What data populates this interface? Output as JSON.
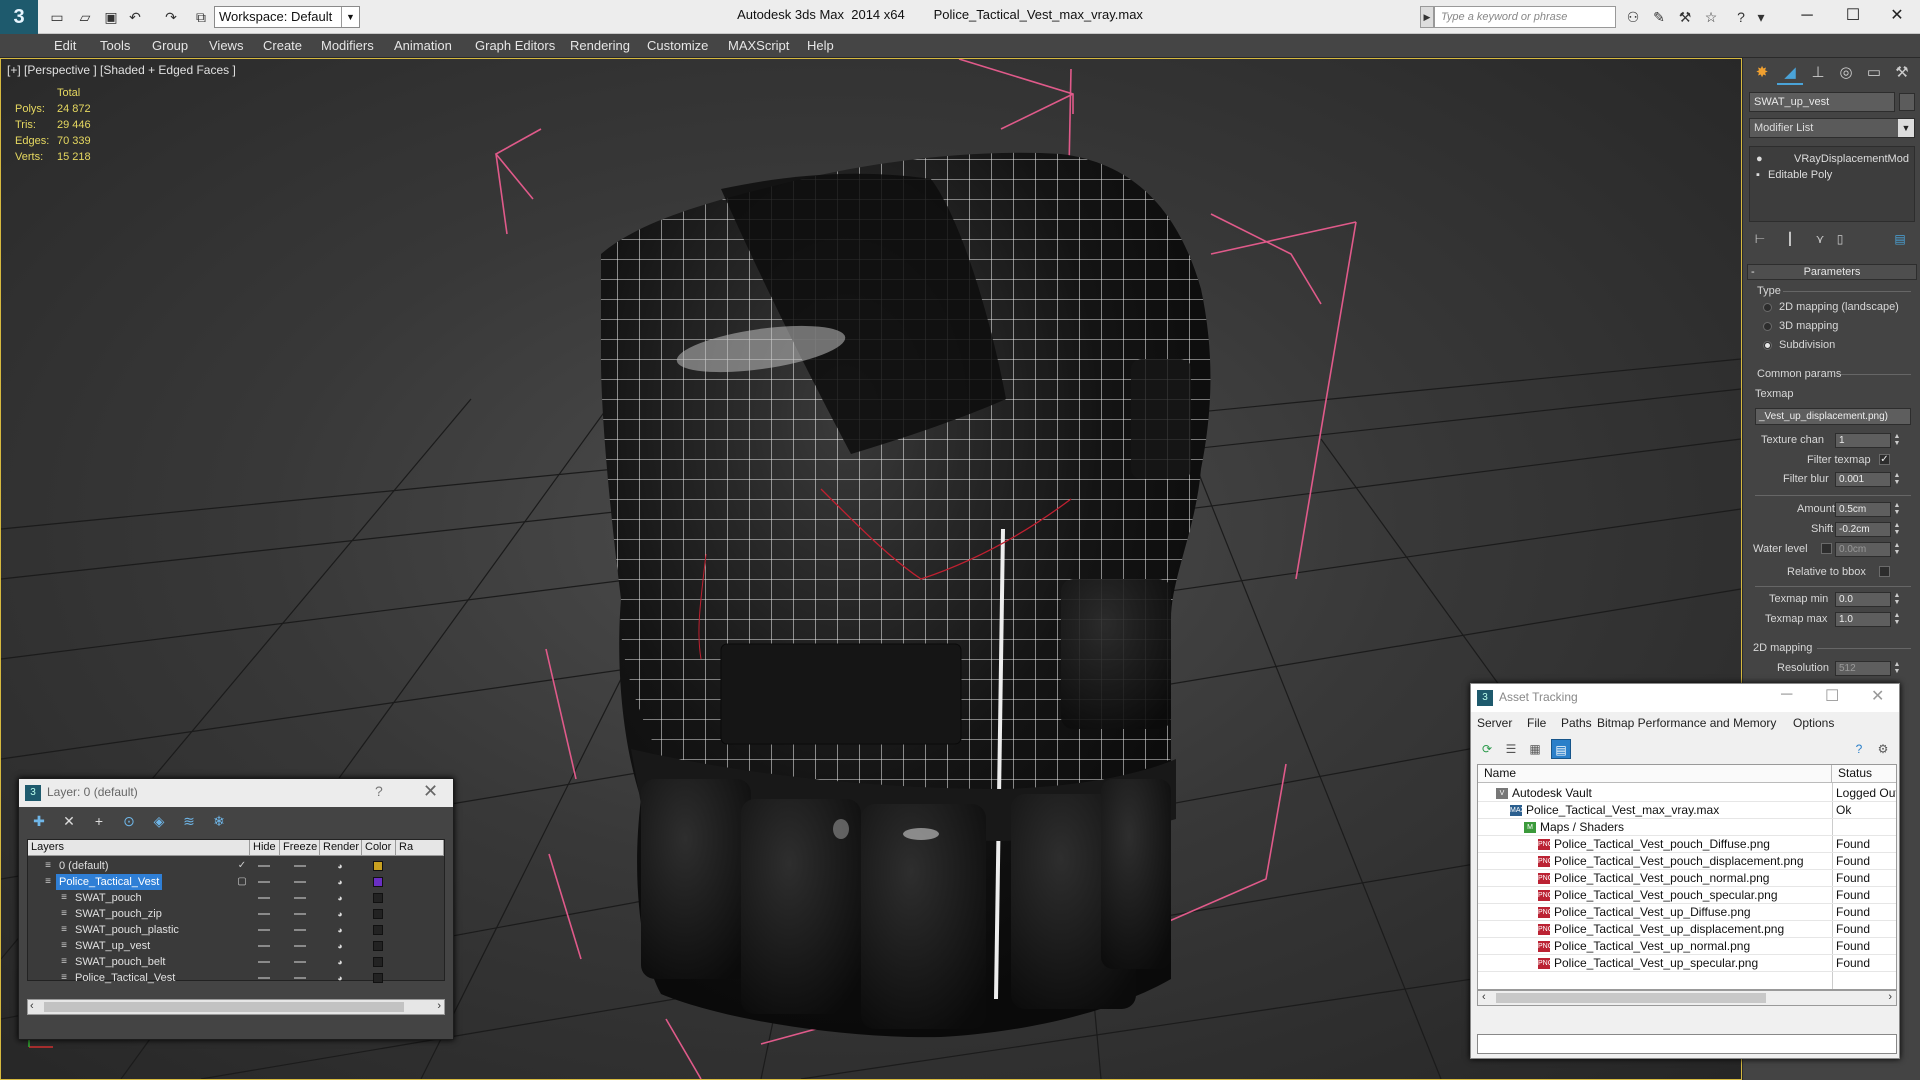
{
  "titlebar": {
    "workspace": "Workspace: Default",
    "app_name": "Autodesk 3ds Max  2014 x64",
    "file_name": "Police_Tactical_Vest_max_vray.max",
    "search_placeholder": "Type a keyword or phrase"
  },
  "menu": [
    "Edit",
    "Tools",
    "Group",
    "Views",
    "Create",
    "Modifiers",
    "Animation",
    "Graph Editors",
    "Rendering",
    "Customize",
    "MAXScript",
    "Help"
  ],
  "viewport": {
    "label": "[+] [Perspective ] [Shaded + Edged Faces ]",
    "stats": {
      "header": "Total",
      "rows": [
        {
          "label": "Polys:",
          "value": "24 872"
        },
        {
          "label": "Tris:",
          "value": "29 446"
        },
        {
          "label": "Edges:",
          "value": "70 339"
        },
        {
          "label": "Verts:",
          "value": "15 218"
        }
      ]
    }
  },
  "command_panel": {
    "object_name": "SWAT_up_vest",
    "modifier_list": "Modifier List",
    "stack": [
      "VRayDisplacementMod",
      "Editable Poly"
    ],
    "rollout_title": "Parameters",
    "type_label": "Type",
    "type_options": [
      {
        "label": "2D mapping (landscape)",
        "selected": false
      },
      {
        "label": "3D mapping",
        "selected": false
      },
      {
        "label": "Subdivision",
        "selected": true
      }
    ],
    "common_params": "Common params",
    "texmap_label": "Texmap",
    "texmap_value": "_Vest_up_displacement.png)",
    "texture_chan_label": "Texture chan",
    "texture_chan_value": "1",
    "filter_texmap_label": "Filter texmap",
    "filter_blur_label": "Filter blur",
    "filter_blur_value": "0.001",
    "amount_label": "Amount",
    "amount_value": "0.5cm",
    "shift_label": "Shift",
    "shift_value": "-0.2cm",
    "water_level_label": "Water level",
    "water_level_value": "0.0cm",
    "relative_bbox_label": "Relative to bbox",
    "texmap_min_label": "Texmap min",
    "texmap_min_value": "0.0",
    "texmap_max_label": "Texmap max",
    "texmap_max_value": "1.0",
    "mapping_2d_label": "2D mapping",
    "resolution_label": "Resolution",
    "resolution_value": "512"
  },
  "layer_dialog": {
    "title": "Layer: 0 (default)",
    "help": "?",
    "columns": [
      "Layers",
      "Hide",
      "Freeze",
      "Render",
      "Color",
      "Ra"
    ],
    "rows": [
      {
        "name": "0 (default)",
        "color": "#c8a020",
        "level": 0
      },
      {
        "name": "Police_Tactical_Vest",
        "color": "#6a2fc4",
        "level": 0
      },
      {
        "name": "SWAT_pouch",
        "color": "#222222",
        "level": 1
      },
      {
        "name": "SWAT_pouch_zip",
        "color": "#222222",
        "level": 1
      },
      {
        "name": "SWAT_pouch_plastic",
        "color": "#222222",
        "level": 1
      },
      {
        "name": "SWAT_up_vest",
        "color": "#222222",
        "level": 1
      },
      {
        "name": "SWAT_pouch_belt",
        "color": "#222222",
        "level": 1
      },
      {
        "name": "Police_Tactical_Vest",
        "color": "#222222",
        "level": 1
      }
    ]
  },
  "asset_tracking": {
    "title": "Asset Tracking",
    "menu": [
      "Server",
      "File",
      "Paths",
      "Bitmap Performance and Memory",
      "Options"
    ],
    "columns": [
      "Name",
      "Status"
    ],
    "rows": [
      {
        "name": "Autodesk Vault",
        "status": "Logged Out",
        "level": 0,
        "icon": "vault"
      },
      {
        "name": "Police_Tactical_Vest_max_vray.max",
        "status": "Ok",
        "level": 1,
        "icon": "max"
      },
      {
        "name": "Maps / Shaders",
        "status": "",
        "level": 2,
        "icon": "maps"
      },
      {
        "name": "Police_Tactical_Vest_pouch_Diffuse.png",
        "status": "Found",
        "level": 3,
        "icon": "png"
      },
      {
        "name": "Police_Tactical_Vest_pouch_displacement.png",
        "status": "Found",
        "level": 3,
        "icon": "png"
      },
      {
        "name": "Police_Tactical_Vest_pouch_normal.png",
        "status": "Found",
        "level": 3,
        "icon": "png"
      },
      {
        "name": "Police_Tactical_Vest_pouch_specular.png",
        "status": "Found",
        "level": 3,
        "icon": "png"
      },
      {
        "name": "Police_Tactical_Vest_up_Diffuse.png",
        "status": "Found",
        "level": 3,
        "icon": "png"
      },
      {
        "name": "Police_Tactical_Vest_up_displacement.png",
        "status": "Found",
        "level": 3,
        "icon": "png"
      },
      {
        "name": "Police_Tactical_Vest_up_normal.png",
        "status": "Found",
        "level": 3,
        "icon": "png"
      },
      {
        "name": "Police_Tactical_Vest_up_specular.png",
        "status": "Found",
        "level": 3,
        "icon": "png"
      }
    ]
  },
  "icons": {
    "png": "PNG",
    "max": "MAX",
    "vault": "V",
    "maps": "M"
  },
  "colors": {
    "viewport_border": "#d6b93f",
    "stats_text": "#e6d860",
    "selection": "#2f7fd6",
    "bbox": "#e05a8a"
  }
}
